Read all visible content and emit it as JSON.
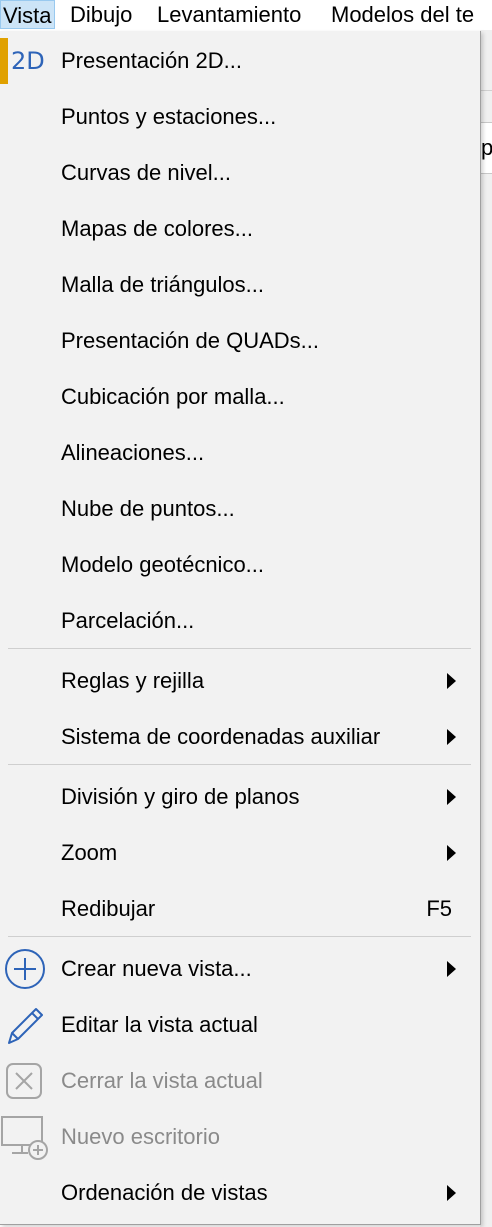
{
  "menubar": {
    "items": [
      {
        "label": "Vista"
      },
      {
        "label": "Dibujo"
      },
      {
        "label": "Levantamiento"
      },
      {
        "label": "Modelos del te"
      }
    ]
  },
  "background": {
    "partial_text": "pa"
  },
  "menu": {
    "items": [
      {
        "label": "Presentación 2D...",
        "icon": "2d-icon",
        "icon_text": "2D",
        "highlight_color": "#e0a100"
      },
      {
        "label": "Puntos y estaciones..."
      },
      {
        "label": "Curvas de nivel..."
      },
      {
        "label": "Mapas de colores..."
      },
      {
        "label": "Malla de triángulos..."
      },
      {
        "label": "Presentación de QUADs..."
      },
      {
        "label": "Cubicación por malla..."
      },
      {
        "label": "Alineaciones..."
      },
      {
        "label": "Nube de puntos..."
      },
      {
        "label": "Modelo geotécnico..."
      },
      {
        "label": "Parcelación..."
      },
      {
        "label": "Reglas y rejilla",
        "submenu": true
      },
      {
        "label": "Sistema de coordenadas auxiliar",
        "submenu": true
      },
      {
        "label": "División y giro de planos",
        "submenu": true
      },
      {
        "label": "Zoom",
        "submenu": true
      },
      {
        "label": "Redibujar",
        "shortcut": "F5"
      },
      {
        "label": "Crear nueva vista...",
        "icon": "plus-circle-icon",
        "submenu": true
      },
      {
        "label": "Editar la vista actual",
        "icon": "pencil-icon"
      },
      {
        "label": "Cerrar la vista actual",
        "icon": "close-box-icon",
        "disabled": true
      },
      {
        "label": "Nuevo escritorio",
        "icon": "monitor-add-icon",
        "disabled": true
      },
      {
        "label": "Ordenación de vistas",
        "submenu": true
      }
    ]
  },
  "colors": {
    "accent": "#e0a100",
    "icon_blue": "#2e64b8",
    "menu_bg": "#f2f2f2",
    "active_menubar": "#cce4f7",
    "disabled_text": "#8a8a8a"
  }
}
